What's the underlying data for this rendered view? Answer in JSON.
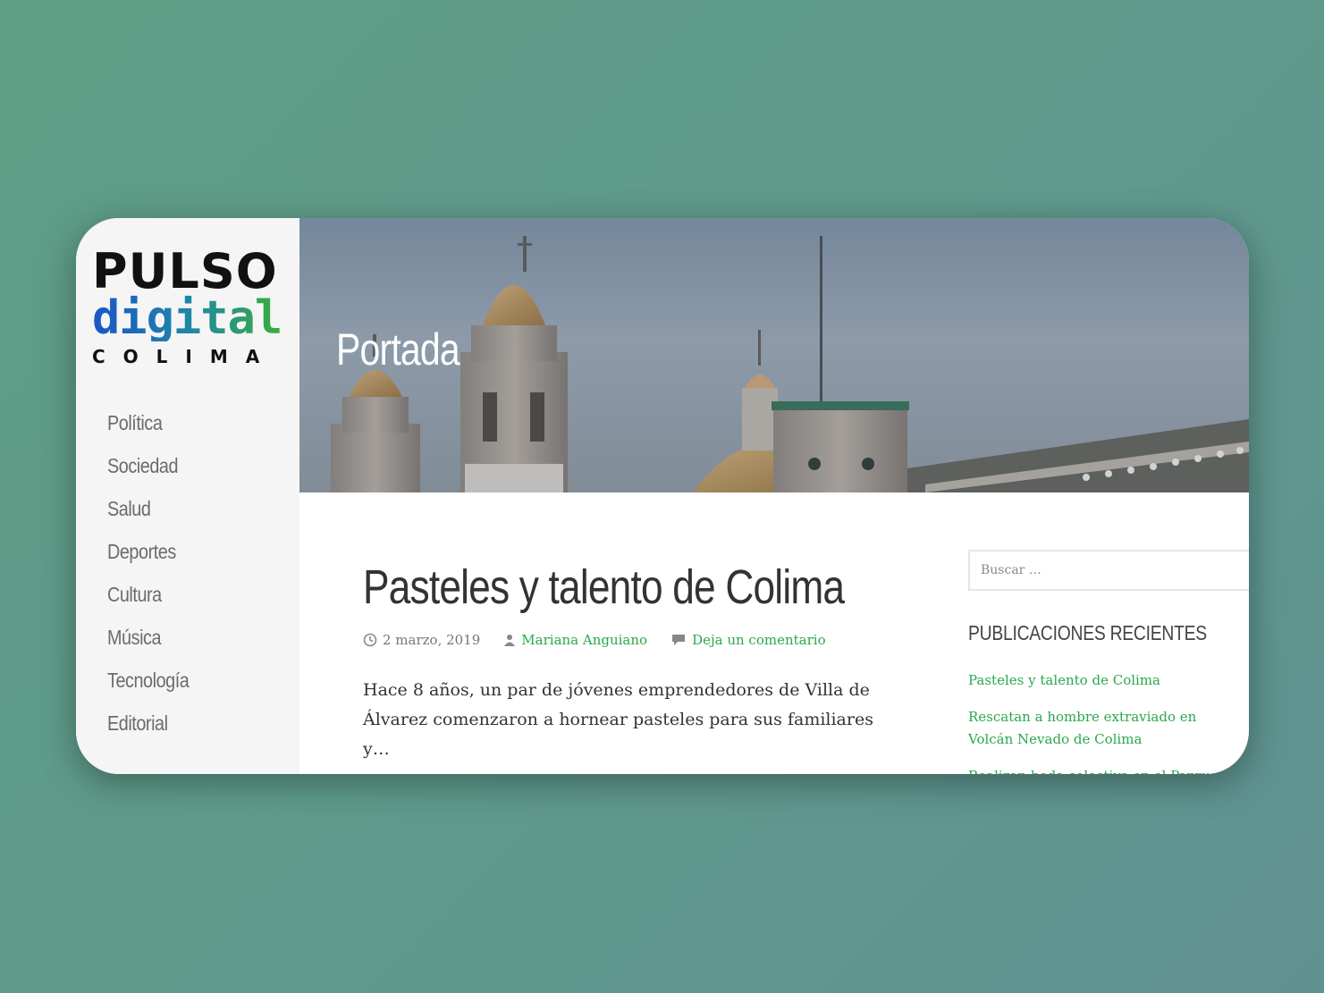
{
  "logo": {
    "line1": "PULSO",
    "line2": "digital",
    "line3": "COLIMA"
  },
  "nav": [
    "Política",
    "Sociedad",
    "Salud",
    "Deportes",
    "Cultura",
    "Música",
    "Tecnología",
    "Editorial"
  ],
  "hero": {
    "title": "Portada"
  },
  "post": {
    "title": "Pasteles y talento de Colima",
    "date": "2 marzo, 2019",
    "author": "Mariana Anguiano",
    "comments": "Deja un comentario",
    "excerpt": "Hace 8 años, un par de jóvenes emprendedores de Villa de Álvarez comenzaron a hornear pasteles para sus familiares y…"
  },
  "search": {
    "placeholder": "Buscar …"
  },
  "recent": {
    "title": "PUBLICACIONES RECIENTES",
    "items": [
      "Pasteles y talento de Colima",
      "Rescatan a hombre extraviado en Volcán Nevado de Colima",
      "Realizan boda colectiva en el Parque"
    ]
  },
  "colors": {
    "accent": "#2aa84a",
    "sidebar_bg": "#f5f5f5",
    "text": "#333333"
  },
  "icons": {
    "date": "clock-icon",
    "author": "user-icon",
    "comments": "comment-icon"
  }
}
